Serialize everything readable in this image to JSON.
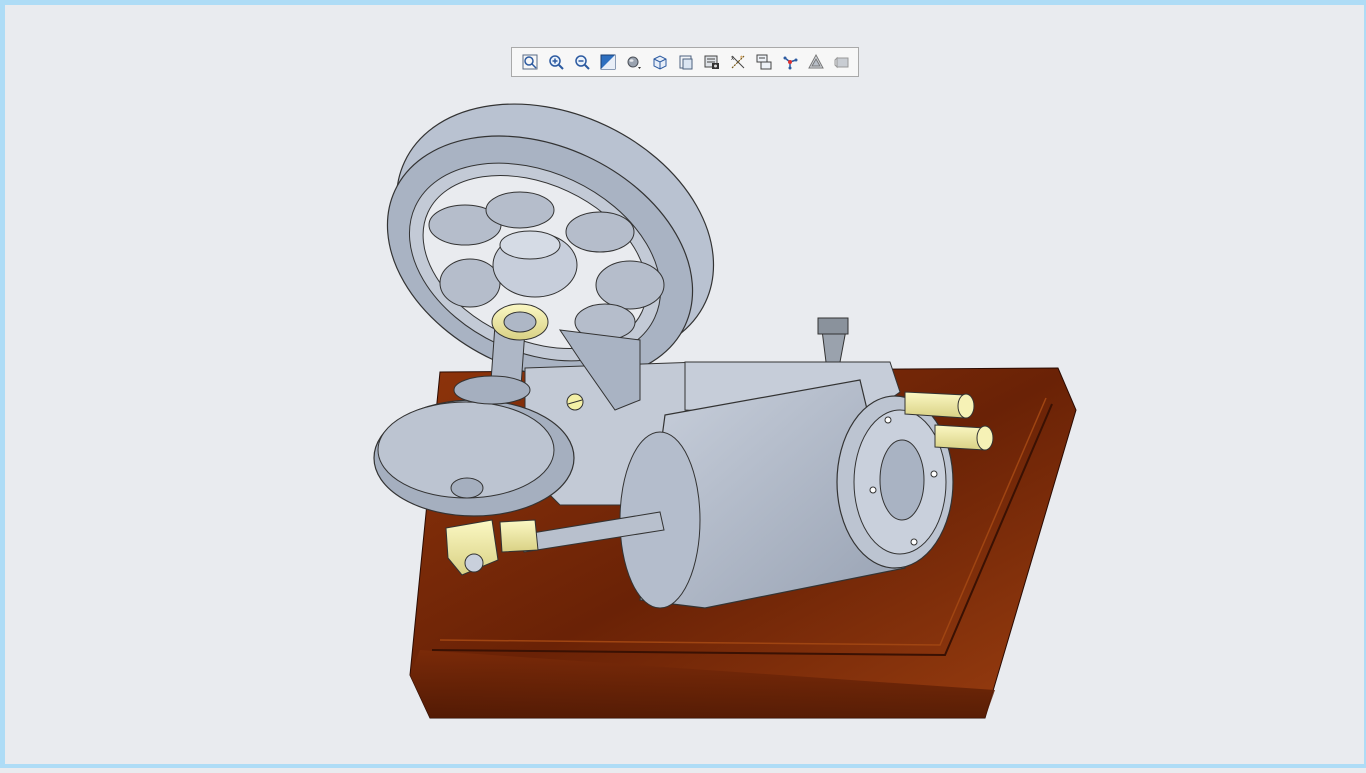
{
  "toolbar": {
    "buttons": [
      {
        "name": "zoom-fit-icon",
        "tooltip": ""
      },
      {
        "name": "zoom-in-icon",
        "tooltip": ""
      },
      {
        "name": "zoom-out-icon",
        "tooltip": ""
      },
      {
        "name": "repaint-icon",
        "tooltip": ""
      },
      {
        "name": "display-style-icon",
        "tooltip": ""
      },
      {
        "name": "saved-orientations-icon",
        "tooltip": ""
      },
      {
        "name": "view-manager-icon",
        "tooltip": ""
      },
      {
        "name": "view-snapshot-icon",
        "tooltip": ""
      },
      {
        "name": "datum-display-icon",
        "tooltip": ""
      },
      {
        "name": "annotation-display-icon",
        "tooltip": ""
      },
      {
        "name": "spin-center-icon",
        "tooltip": ""
      },
      {
        "name": "perspective-icon",
        "tooltip": ""
      },
      {
        "name": "more-options-icon",
        "tooltip": ""
      }
    ]
  },
  "colors": {
    "background": "#e9ebef",
    "frame": "#aedcf6",
    "metal": "#b7c0cf",
    "metal_dark": "#8d97a8",
    "brass": "#f4f0a6",
    "wood": "#7a2a08"
  }
}
